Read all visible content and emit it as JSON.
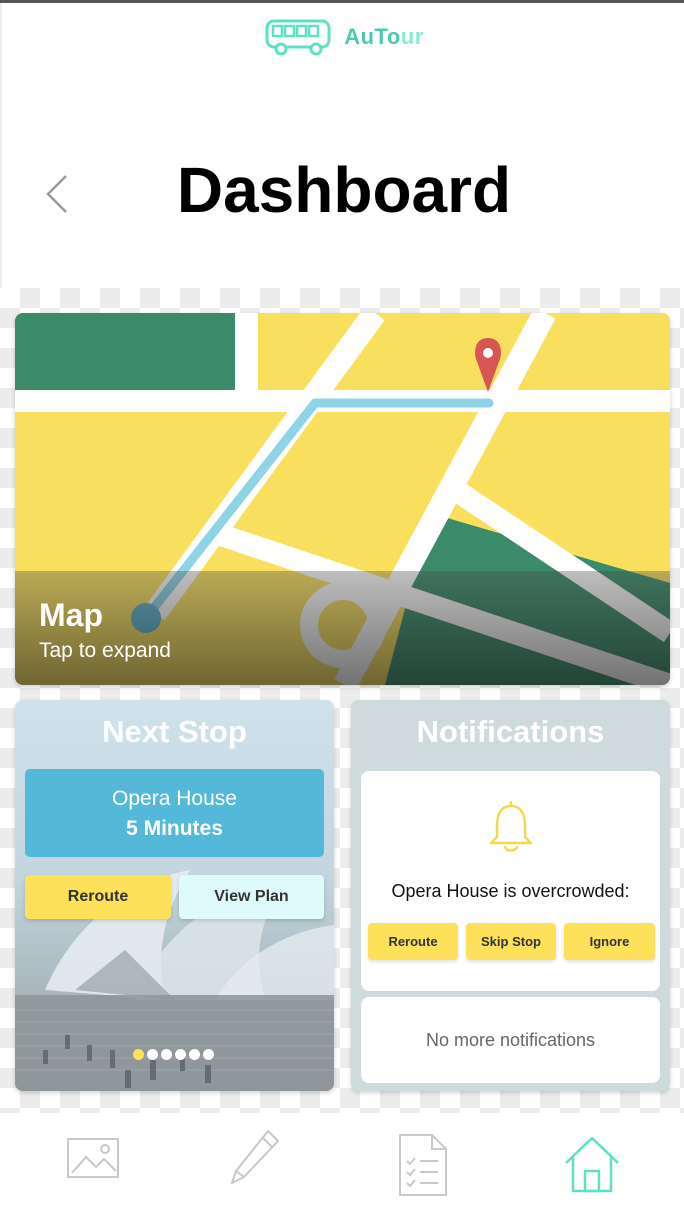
{
  "app": {
    "brand_part1": "AuTo",
    "brand_part2": "ur"
  },
  "header": {
    "title": "Dashboard"
  },
  "map_card": {
    "title": "Map",
    "subtitle": "Tap to expand"
  },
  "next_stop": {
    "title": "Next Stop",
    "stop_name": "Opera House",
    "eta": "5 Minutes",
    "reroute_label": "Reroute",
    "view_plan_label": "View Plan",
    "carousel": {
      "total": 6,
      "active_index": 0
    }
  },
  "notifications": {
    "title": "Notifications",
    "message": "Opera House is overcrowded:",
    "actions": [
      "Reroute",
      "Skip Stop",
      "Ignore"
    ],
    "empty_text": "No more notifications"
  },
  "tabbar": {
    "items": [
      "image-icon",
      "pencil-icon",
      "checklist-icon",
      "home-icon"
    ],
    "active_index": 3
  },
  "colors": {
    "brand": "#5fe0c4",
    "accent_yellow": "#fde15a",
    "map_yellow": "#f8df5e",
    "map_green": "#3b8b6a",
    "route_blue": "#8fd3e8",
    "pin_red": "#d95555",
    "stop_box": "#54b9d9"
  }
}
